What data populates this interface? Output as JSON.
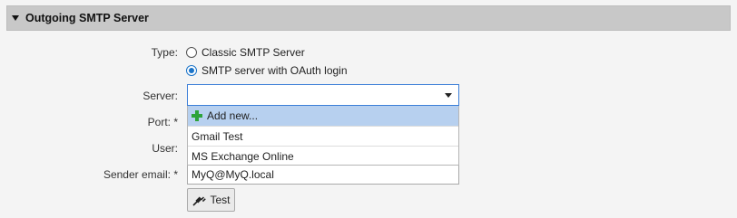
{
  "section": {
    "title": "Outgoing SMTP Server"
  },
  "form": {
    "type_label": "Type:",
    "type_options": [
      {
        "label": "Classic SMTP Server",
        "selected": false
      },
      {
        "label": "SMTP server with OAuth login",
        "selected": true
      }
    ],
    "server_label": "Server:",
    "server_value": "",
    "server_dropdown": {
      "add_new": "Add new...",
      "options": [
        "Gmail Test",
        "MS Exchange Online"
      ]
    },
    "port_label": "Port:",
    "user_label": "User:",
    "sender_email_label": "Sender email:",
    "sender_email_value": "MyQ@MyQ.local",
    "required_mark": "*",
    "test_button": "Test"
  },
  "icons": {
    "section_toggle": "caret-down-icon",
    "add": "plus-icon",
    "test": "plug-icon",
    "dropdown": "chevron-down-icon"
  },
  "colors": {
    "accent": "#1a73c8",
    "highlight": "#b7d0ef",
    "plus": "#2ea33a",
    "header": "#c8c8c8"
  }
}
